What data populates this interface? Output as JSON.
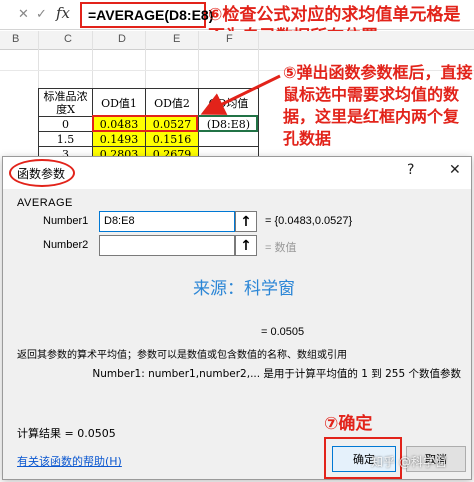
{
  "formula_bar": {
    "cancel_glyph": "✕",
    "enter_glyph": "✓",
    "fx_label": "fx",
    "formula": "=AVERAGE(D8:E8)"
  },
  "annotations": {
    "step6": "⑥检查公式对应的求均值单元格是否为自己数据所在位置",
    "step5": "⑤弹出函数参数框后，直接鼠标选中需要求均值的数据，这里是红框内两个复孔数据",
    "step7": "⑦确定"
  },
  "columns": [
    "B",
    "C",
    "D",
    "E",
    "F"
  ],
  "table": {
    "headers": [
      "标准品浓度X",
      "OD值1",
      "OD值2",
      "OD均值"
    ],
    "rows": [
      {
        "x": "0",
        "od1": "0.0483",
        "od2": "0.0527",
        "avg": "(D8:E8)"
      },
      {
        "x": "1.5",
        "od1": "0.1493",
        "od2": "0.1516",
        "avg": ""
      },
      {
        "x": "3",
        "od1": "0.2803",
        "od2": "0.2679",
        "avg": ""
      }
    ]
  },
  "dialog": {
    "title": "函数参数",
    "help_glyph": "?",
    "close_glyph": "✕",
    "function_name": "AVERAGE",
    "args": [
      {
        "label": "Number1",
        "value": "D8:E8",
        "result": "= {0.0483,0.0527}"
      },
      {
        "label": "Number2",
        "value": "",
        "result": "= 数值"
      }
    ],
    "watermark": "来源：科学窗",
    "formula_result": "= 0.0505",
    "description": "返回其参数的算术平均值；参数可以是数值或包含数值的名称、数组或引用",
    "arg_description": "Number1:   number1,number2,... 是用于计算平均值的 1 到 255 个数值参数",
    "calc_result": "计算结果 =   0.0505",
    "help_link": "有关该函数的帮助(H)",
    "ok_label": "确定",
    "cancel_label": "取消",
    "zhihu_watermark": "知乎 @科学窗"
  },
  "colors": {
    "annotation_red": "#e2231a",
    "highlight_yellow": "#ffff00",
    "link_blue": "#0b57d0",
    "watermark_blue": "#2b86d6"
  }
}
